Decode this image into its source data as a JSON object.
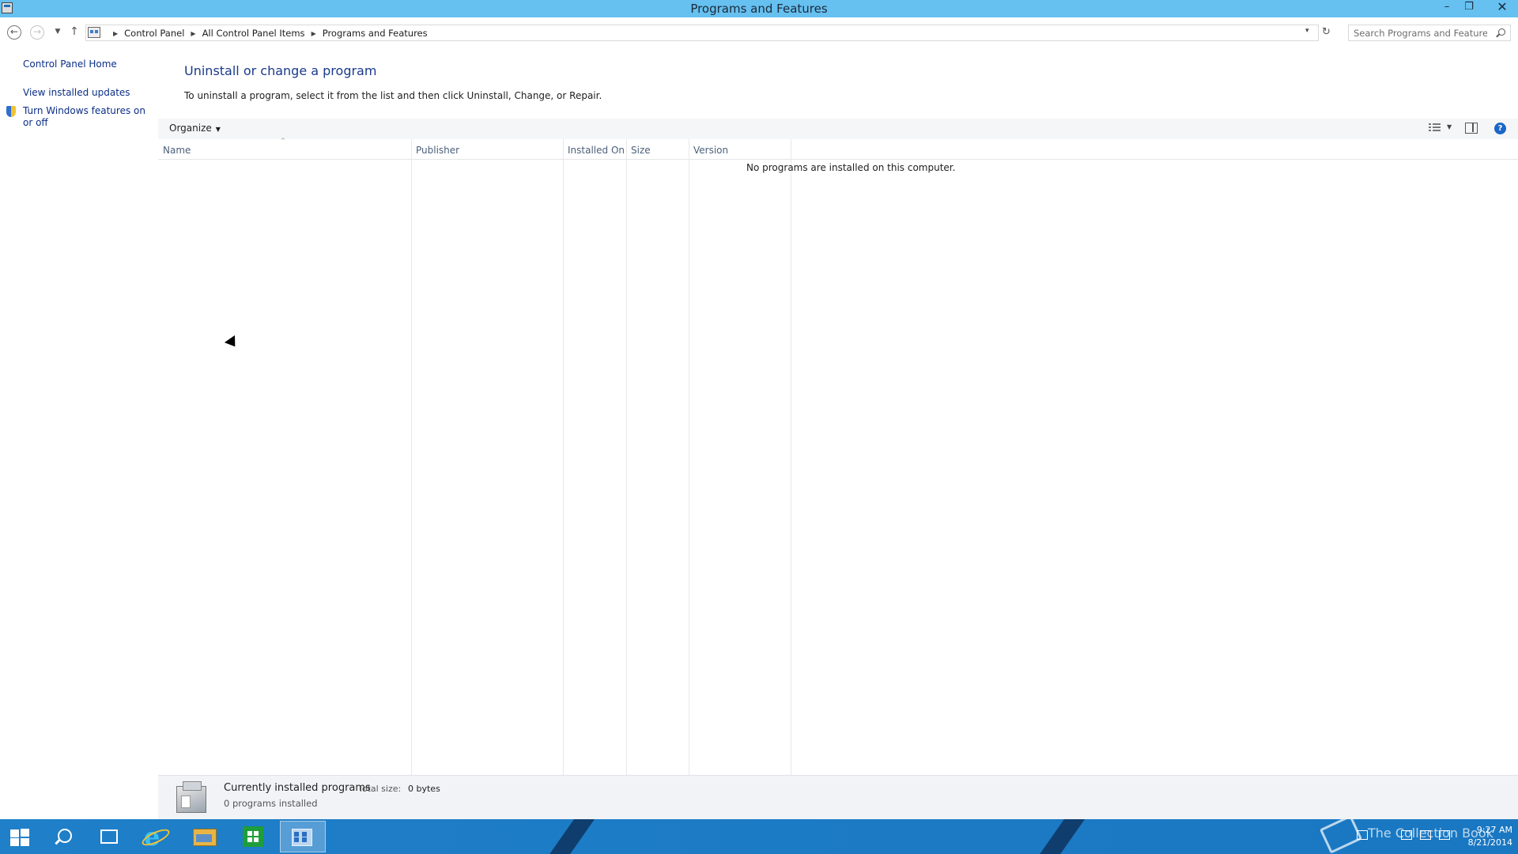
{
  "window": {
    "title": "Programs and Features",
    "minimize": "–",
    "maximize": "❐",
    "close": "✕"
  },
  "navbar": {
    "back": "←",
    "forward": "→",
    "recent": "▼",
    "up": "↑",
    "breadcrumbs": [
      "Control Panel",
      "All Control Panel Items",
      "Programs and Features"
    ],
    "crumb_separator": "▶",
    "address_dropdown": "▾",
    "refresh": "↻",
    "search_placeholder": "Search Programs and Features"
  },
  "sidebar": {
    "home": "Control Panel Home",
    "updates": "View installed updates",
    "features": "Turn Windows features on or off"
  },
  "main": {
    "heading": "Uninstall or change a program",
    "description": "To uninstall a program, select it from the list and then click Uninstall, Change, or Repair.",
    "organize": "Organize",
    "organize_caret": "▼",
    "views_caret": "▼",
    "help": "?",
    "columns": [
      "Name",
      "Publisher",
      "Installed On",
      "Size",
      "Version"
    ],
    "sort_arrow": "^",
    "empty_message": "No programs are installed on this computer."
  },
  "details": {
    "title": "Currently installed programs",
    "size_label": "Total size:",
    "size_value": "0 bytes",
    "count": "0 programs installed"
  },
  "taskbar": {
    "ie_glyph": "e",
    "watermark": "The Collection Book",
    "time": "9:27 AM",
    "date": "8/21/2014"
  },
  "colors": {
    "titlebar": "#66c0f0",
    "link": "#0b2e86",
    "heading": "#1a3a8a",
    "taskbar": "#1f7fc8"
  },
  "icons": [
    "app-icon",
    "back-icon",
    "forward-icon",
    "recent-locations-icon",
    "up-icon",
    "control-panel-icon",
    "refresh-icon",
    "search-icon",
    "shield-icon",
    "views-icon",
    "preview-pane-icon",
    "help-icon",
    "program-box-icon",
    "start-icon",
    "search-charm-icon",
    "task-view-icon",
    "internet-explorer-icon",
    "file-explorer-icon",
    "store-icon",
    "control-panel-taskbar-icon",
    "book-icon"
  ]
}
